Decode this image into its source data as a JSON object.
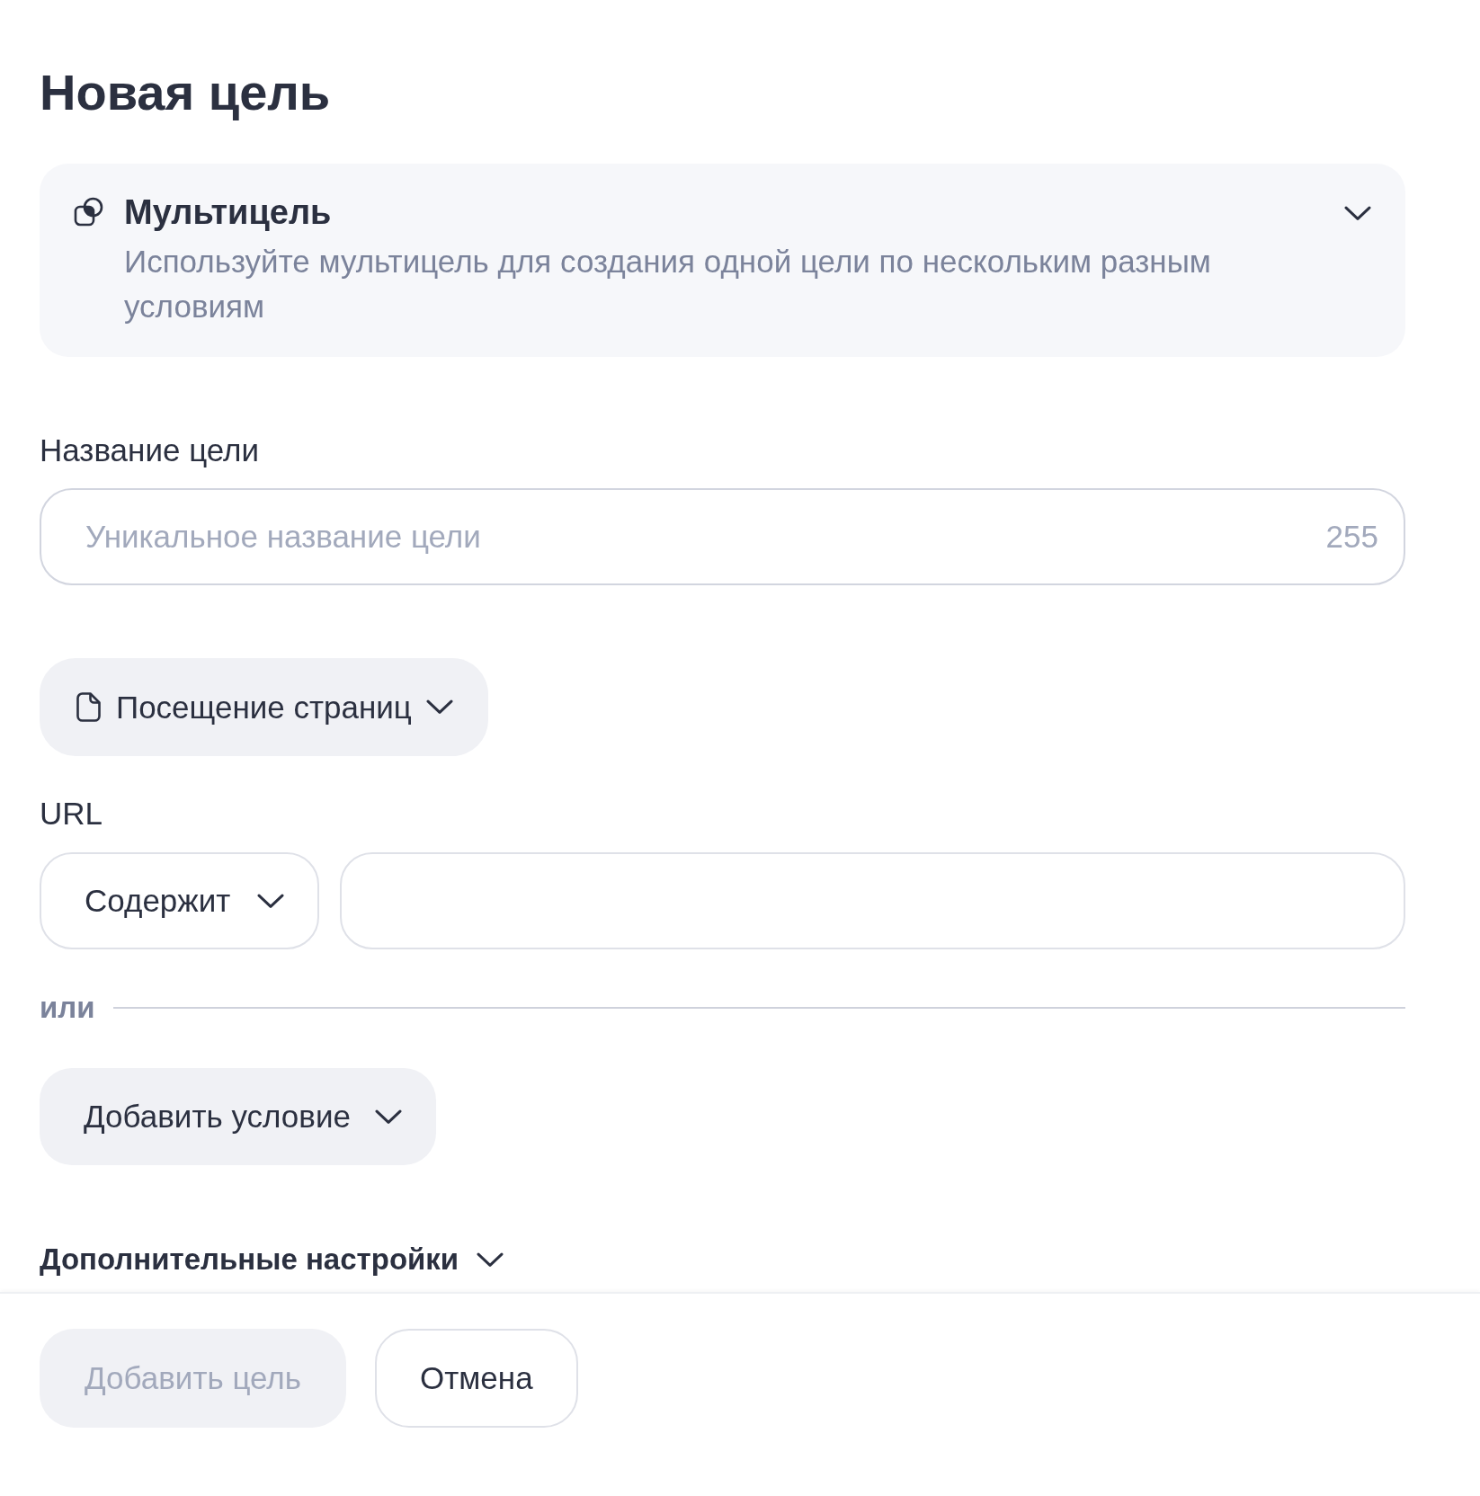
{
  "page": {
    "title": "Новая цель"
  },
  "multigoal_panel": {
    "title": "Мультицель",
    "description": "Используйте мультицель для создания одной цели по нескольким разным условиям",
    "expanded": false
  },
  "goal_name": {
    "label": "Название цели",
    "placeholder": "Уникальное название цели",
    "counter": "255"
  },
  "condition_type": {
    "label": "Посещение страниц"
  },
  "url_condition": {
    "label": "URL",
    "operator": "Содержит"
  },
  "separator": {
    "label": "или"
  },
  "add_condition": {
    "label": "Добавить условие"
  },
  "advanced_settings": {
    "label": "Дополнительные настройки",
    "expanded": false
  },
  "footer": {
    "buttons": [
      {
        "label": "Добавить цель",
        "disabled": true
      },
      {
        "label": "Отмена",
        "disabled": false
      }
    ]
  }
}
